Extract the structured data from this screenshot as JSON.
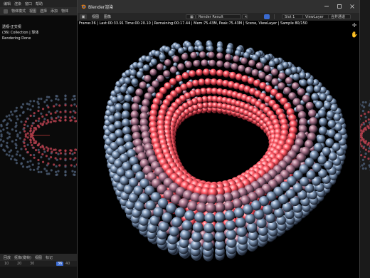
{
  "background_app": {
    "menu": [
      "编辑",
      "渲染",
      "窗口",
      "帮助"
    ],
    "header_items": [
      "物体模式",
      "视图",
      "选择",
      "添加",
      "物体"
    ],
    "overlay": {
      "line1": "透视-正交视",
      "line2": "(36) Collection | 球体",
      "line3": "Rendering Done"
    },
    "timeline": {
      "menu": [
        "回放",
        "抠像(键帧)",
        "视图",
        "标记"
      ],
      "ruler": [
        "10",
        "20",
        "30",
        "36",
        "40"
      ],
      "current_frame": "36"
    }
  },
  "render_window": {
    "title": "Blender渲染",
    "toolbar": {
      "menus": [
        "视图",
        "图像"
      ],
      "image_name": "Render Result",
      "slot": "Slot 1",
      "layer": "ViewLayer",
      "pass": "合并通道"
    },
    "stats": "Frame:36 | Last:00:33.91 Time:00:20.10 | Remaining:00:17.44 | Mem:75.43M, Peak:75.43M | Scene, ViewLayer | Sample 80/150",
    "colors": {
      "background": "#000000",
      "sphere_outer": "#7f97b6",
      "sphere_inner": "#ff5a66",
      "titlebar": "#303030"
    }
  }
}
